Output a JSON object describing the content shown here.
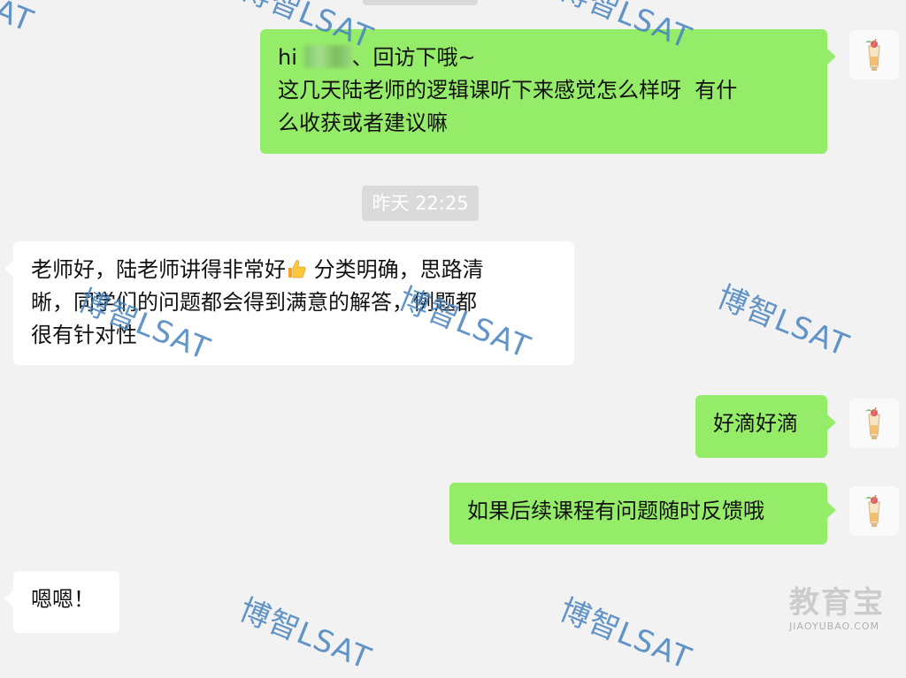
{
  "conversation": {
    "timestamp": "昨天 22:25",
    "messages": [
      {
        "direction": "sent",
        "greeting_prefix": "hi ",
        "greeting_suffix": "、回访下哦~",
        "text": "这几天陆老师的逻辑课听下来感觉怎么样呀  有什\n么收获或者建议嘛"
      },
      {
        "direction": "received",
        "text_a": "老师好，陆老师讲得非常好",
        "emoji": "thumbs-up-icon",
        "text_b": " 分类明确，思路清\n晰，同学们的问题都会得到满意的解答，例题都\n很有针对性"
      },
      {
        "direction": "sent",
        "text": "好滴好滴"
      },
      {
        "direction": "sent",
        "text": "如果后续课程有问题随时反馈哦"
      },
      {
        "direction": "received",
        "text": "嗯嗯！"
      }
    ]
  },
  "watermark": {
    "text": "博智LSAT",
    "partial_top": "LSAT",
    "partial_left": "AT",
    "color": "#4682be"
  },
  "site_logo": {
    "cn": "教育宝",
    "en": "JIAOYUBAO.COM"
  },
  "colors": {
    "sent_bubble": "#95ec69",
    "received_bubble": "#ffffff",
    "background": "#f2f2f2",
    "time_badge": "#dadada"
  }
}
